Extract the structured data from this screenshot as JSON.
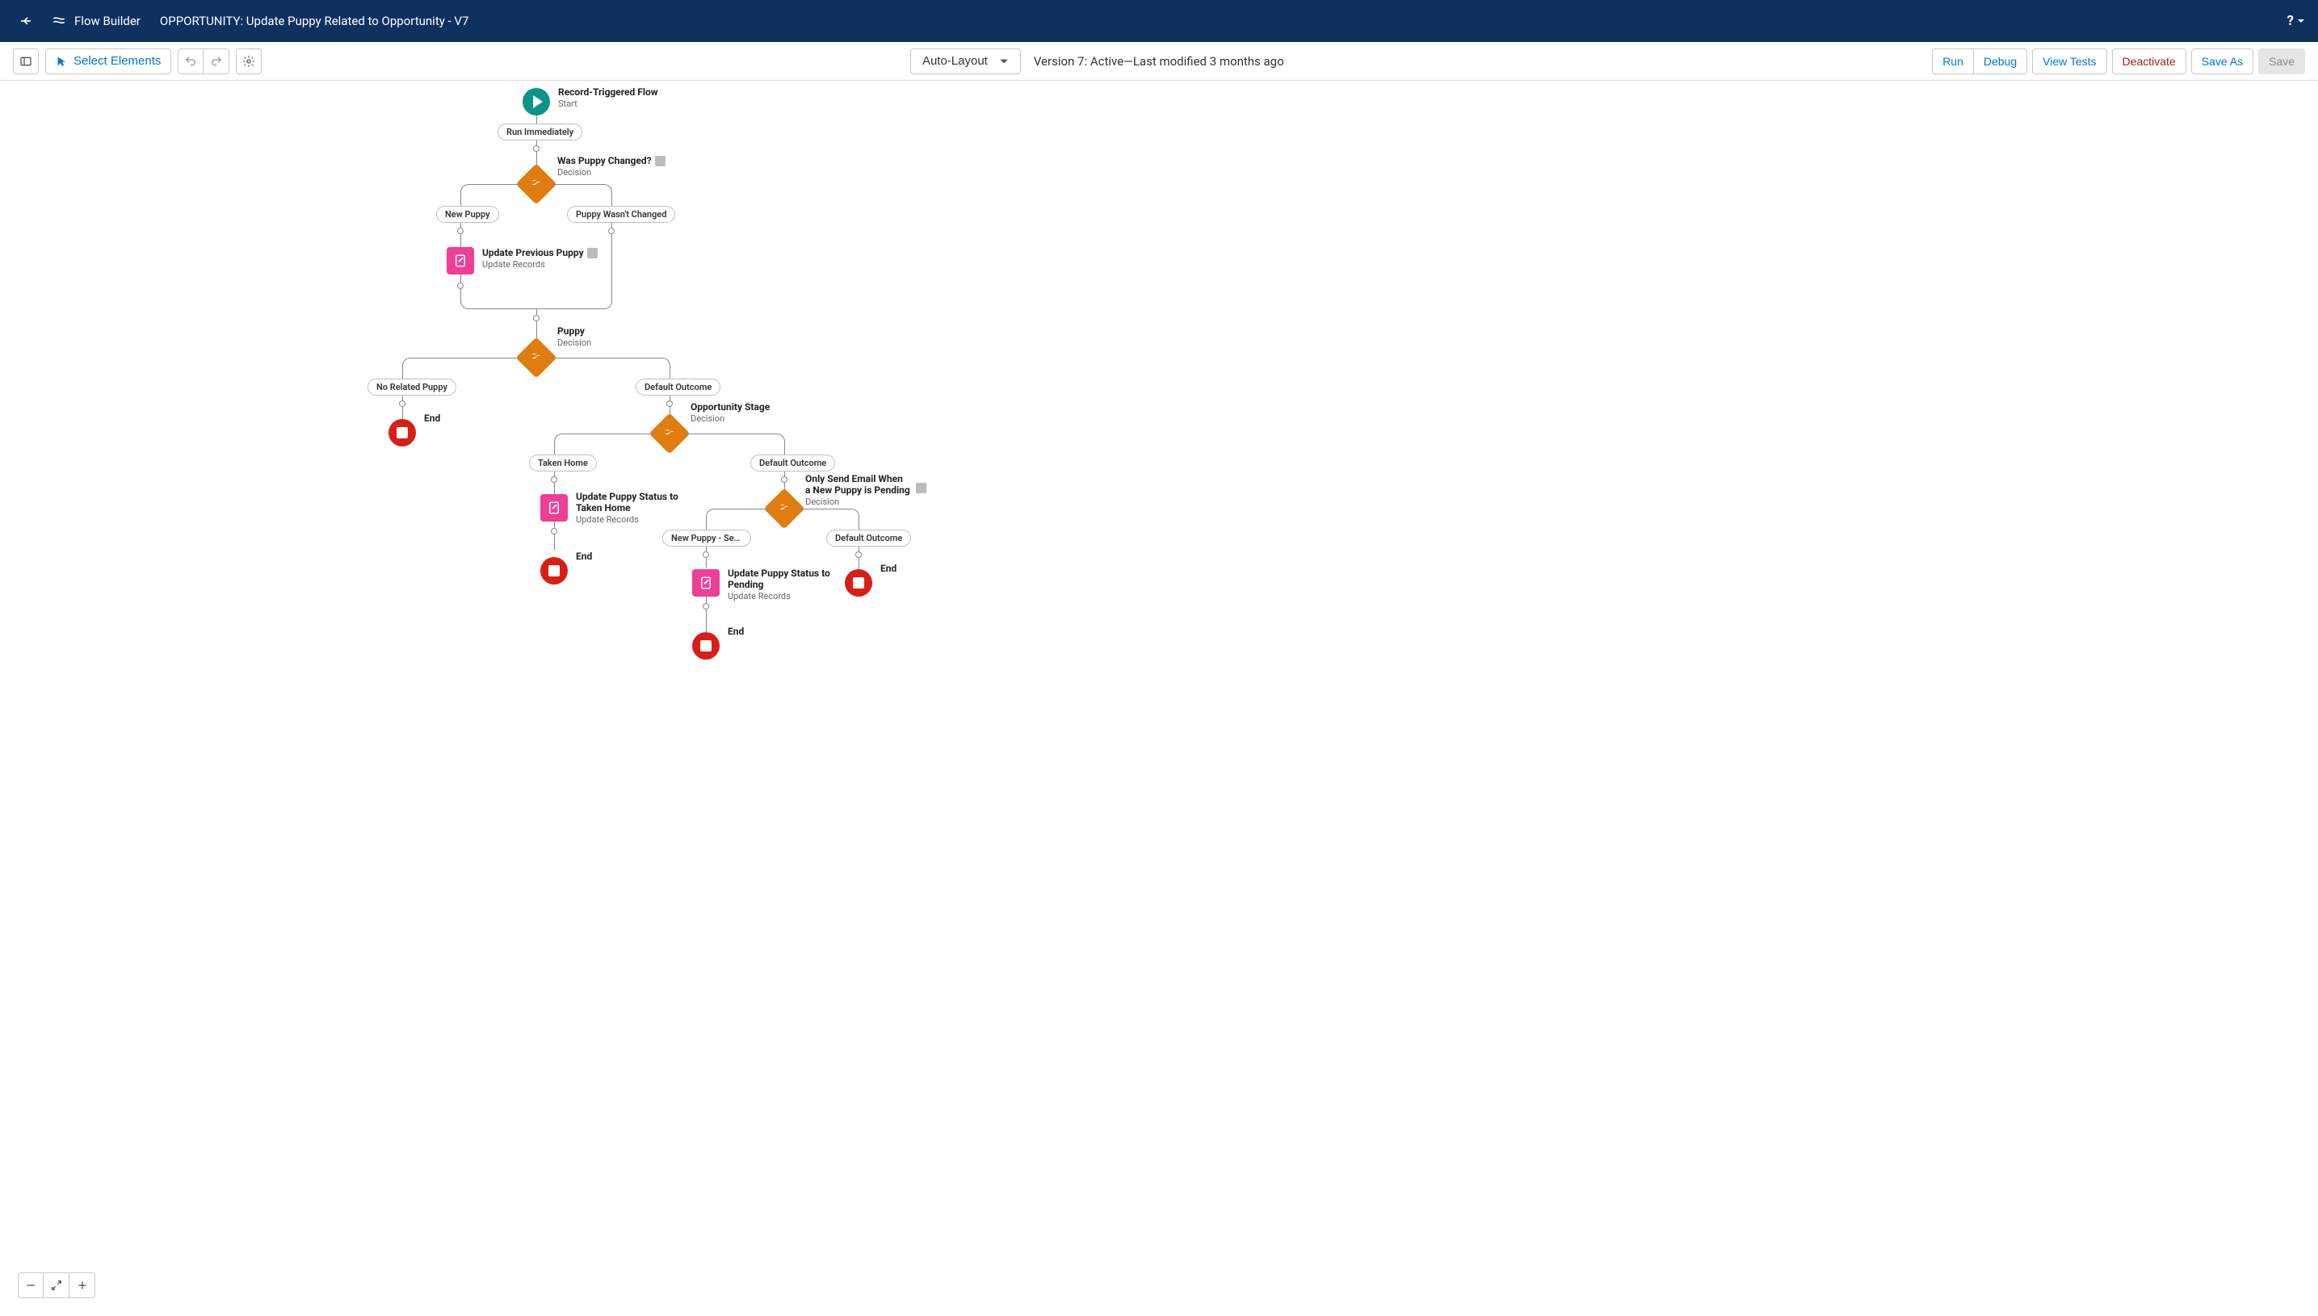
{
  "header": {
    "app_name": "Flow Builder",
    "title": "OPPORTUNITY: Update Puppy Related to Opportunity - V7",
    "help": "?"
  },
  "toolbar": {
    "select_elements": "Select Elements",
    "auto_layout": "Auto-Layout",
    "version_text": "Version 7: Active—Last modified 3 months ago",
    "run": "Run",
    "debug": "Debug",
    "view_tests": "View Tests",
    "deactivate": "Deactivate",
    "save_as": "Save As",
    "save": "Save"
  },
  "flow": {
    "start": {
      "title": "Record-Triggered Flow",
      "sub": "Start"
    },
    "run_immediately": "Run Immediately",
    "decision1": {
      "title": "Was Puppy Changed?",
      "sub": "Decision"
    },
    "outcome_new_puppy": "New Puppy",
    "outcome_not_changed": "Puppy Wasn't Changed",
    "update_prev": {
      "title": "Update Previous Puppy",
      "sub": "Update Records"
    },
    "decision2": {
      "title": "Puppy",
      "sub": "Decision"
    },
    "outcome_no_related": "No Related Puppy",
    "outcome_default1": "Default Outcome",
    "end1": "End",
    "decision3": {
      "title": "Opportunity Stage",
      "sub": "Decision"
    },
    "outcome_taken_home": "Taken Home",
    "outcome_default2": "Default Outcome",
    "update_taken_home": {
      "title": "Update Puppy Status to Taken Home",
      "sub": "Update Records"
    },
    "end2": "End",
    "decision4": {
      "title": "Only Send Email When a New Puppy is Pending",
      "sub": "Decision"
    },
    "outcome_send_pe": "New Puppy - Send 'Pe...",
    "outcome_default3": "Default Outcome",
    "update_pending": {
      "title": "Update Puppy Status to Pending",
      "sub": "Update Records"
    },
    "end3": "End",
    "end4": "End"
  }
}
